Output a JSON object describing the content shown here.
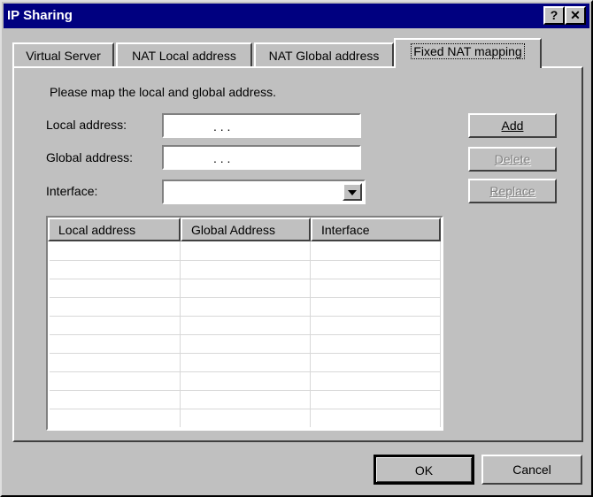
{
  "window": {
    "title": "IP Sharing",
    "help_glyph": "?",
    "close_glyph": "✕"
  },
  "tabs": [
    {
      "label": "Virtual Server",
      "active": false
    },
    {
      "label": "NAT Local address",
      "active": false
    },
    {
      "label": "NAT Global address",
      "active": false
    },
    {
      "label": "Fixed NAT mapping",
      "active": true
    }
  ],
  "form": {
    "instruction": "Please map the local and global address.",
    "local_address_label": "Local address:",
    "global_address_label": "Global address:",
    "interface_label": "Interface:",
    "local_address_value": ".     .     .",
    "global_address_value": ".     .     .",
    "interface_value": ""
  },
  "side_buttons": {
    "add": "Add",
    "delete": "Delete",
    "replace": "Replace"
  },
  "table": {
    "columns": [
      "Local address",
      "Global Address",
      "Interface"
    ],
    "rows": []
  },
  "footer": {
    "ok": "OK",
    "cancel": "Cancel"
  },
  "colors": {
    "titlebar": "#000080",
    "face": "#c0c0c0"
  }
}
